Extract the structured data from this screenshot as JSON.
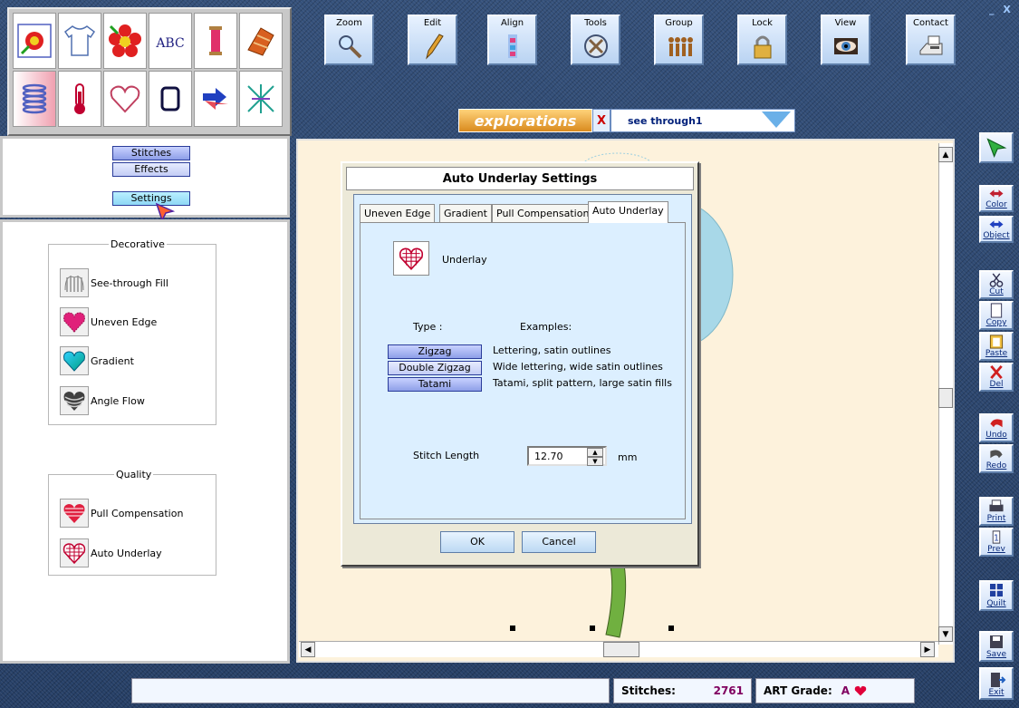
{
  "window_controls": {
    "minimize": "_",
    "close": "X"
  },
  "palette": {
    "items": [
      {
        "icon": "multi-hoop-flower-icon"
      },
      {
        "icon": "tshirt-icon"
      },
      {
        "icon": "flower-icon"
      },
      {
        "icon": "abc-lettering-icon",
        "text": "ABC"
      },
      {
        "icon": "thread-spool-icon"
      },
      {
        "icon": "fabric-swatch-icon"
      },
      {
        "icon": "spring-coil-icon"
      },
      {
        "icon": "thermometer-icon"
      },
      {
        "icon": "heart-outline-icon"
      },
      {
        "icon": "hoop-icon"
      },
      {
        "icon": "convert-arrows-icon"
      },
      {
        "icon": "pattern-stitch-icon"
      }
    ]
  },
  "toolbar": {
    "zoom": "Zoom",
    "edit": "Edit",
    "align": "Align",
    "tools": "Tools",
    "group": "Group",
    "lock": "Lock",
    "view": "View",
    "contact": "Contact"
  },
  "explorations": {
    "logo": "explorations",
    "close_glyph": "X",
    "selected": "see through1"
  },
  "left_panel": {
    "stitches": "Stitches",
    "effects": "Effects",
    "settings": "Settings",
    "decorative_title": "Decorative",
    "decorative_items": [
      "See-through Fill",
      "Uneven Edge",
      "Gradient",
      "Angle Flow"
    ],
    "quality_title": "Quality",
    "quality_items": [
      "Pull Compensation",
      "Auto Underlay"
    ]
  },
  "dialog": {
    "title": "Auto Underlay Settings",
    "tabs": [
      "Uneven Edge",
      "Gradient",
      "Pull Compensation",
      "Auto Underlay"
    ],
    "active_tab": "Auto Underlay",
    "underlay_label": "Underlay",
    "type_label": "Type :",
    "examples_label": "Examples:",
    "types": [
      {
        "name": "Zigzag",
        "example": "Lettering, satin outlines"
      },
      {
        "name": "Double Zigzag",
        "example": "Wide lettering, wide satin outlines"
      },
      {
        "name": "Tatami",
        "example": "Tatami, split pattern, large satin fills"
      }
    ],
    "stitch_length_label": "Stitch Length",
    "stitch_length_value": "12.70",
    "stitch_length_unit": "mm",
    "ok": "OK",
    "cancel": "Cancel"
  },
  "sidebar": {
    "color": "Color",
    "object": "Object",
    "cut": "Cut",
    "copy": "Copy",
    "paste": "Paste",
    "del": "Del",
    "undo": "Undo",
    "redo": "Redo",
    "print": "Print",
    "prev": "Prev",
    "quilt": "Quilt",
    "save": "Save",
    "exit": "Exit"
  },
  "status": {
    "message": "",
    "stitches_label": "Stitches:",
    "stitches_value": "2761",
    "grade_label": "ART Grade:",
    "grade_value": "A",
    "grade_icon": "heart-icon"
  },
  "colors": {
    "accent_blue": "#8e9fe8",
    "stitch_count": "#800060",
    "heart_red": "#e0003a",
    "canvas_bg": "#fdf2dc",
    "dialog_panel": "#dcefff"
  }
}
